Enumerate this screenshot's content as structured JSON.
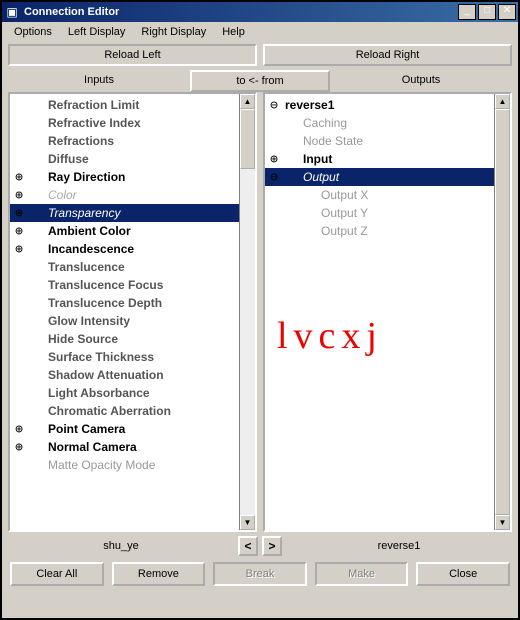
{
  "window": {
    "title": "Connection Editor"
  },
  "menu": [
    "Options",
    "Left Display",
    "Right Display",
    "Help"
  ],
  "buttons": {
    "reload_left": "Reload Left",
    "reload_right": "Reload Right",
    "clear_all": "Clear All",
    "remove": "Remove",
    "break_": "Break",
    "make": "Make",
    "close": "Close"
  },
  "headers": {
    "inputs": "Inputs",
    "outputs": "Outputs",
    "tofrom": "to <- from"
  },
  "status": {
    "left": "shu_ye",
    "right": "reverse1"
  },
  "watermark": "lvcxj",
  "left_items": [
    {
      "label": "Refraction Limit",
      "style": "darkgray",
      "indent": 1,
      "exp": ""
    },
    {
      "label": "Refractive Index",
      "style": "darkgray",
      "indent": 1,
      "exp": ""
    },
    {
      "label": "Refractions",
      "style": "darkgray",
      "indent": 1,
      "exp": ""
    },
    {
      "label": "Diffuse",
      "style": "darkgray",
      "indent": 1,
      "exp": ""
    },
    {
      "label": "Ray Direction",
      "style": "bold",
      "indent": 1,
      "exp": "plus"
    },
    {
      "label": "Color",
      "style": "italic",
      "indent": 1,
      "exp": "plus"
    },
    {
      "label": "Transparency",
      "style": "sel",
      "indent": 1,
      "exp": "plus"
    },
    {
      "label": "Ambient Color",
      "style": "bold",
      "indent": 1,
      "exp": "plus"
    },
    {
      "label": "Incandescence",
      "style": "bold",
      "indent": 1,
      "exp": "plus"
    },
    {
      "label": "Translucence",
      "style": "darkgray",
      "indent": 1,
      "exp": ""
    },
    {
      "label": "Translucence Focus",
      "style": "darkgray",
      "indent": 1,
      "exp": ""
    },
    {
      "label": "Translucence Depth",
      "style": "darkgray",
      "indent": 1,
      "exp": ""
    },
    {
      "label": "Glow Intensity",
      "style": "darkgray",
      "indent": 1,
      "exp": ""
    },
    {
      "label": "Hide Source",
      "style": "darkgray",
      "indent": 1,
      "exp": ""
    },
    {
      "label": "Surface Thickness",
      "style": "darkgray",
      "indent": 1,
      "exp": ""
    },
    {
      "label": "Shadow Attenuation",
      "style": "darkgray",
      "indent": 1,
      "exp": ""
    },
    {
      "label": "Light Absorbance",
      "style": "darkgray",
      "indent": 1,
      "exp": ""
    },
    {
      "label": "Chromatic Aberration",
      "style": "darkgray",
      "indent": 1,
      "exp": ""
    },
    {
      "label": "Point Camera",
      "style": "bold",
      "indent": 1,
      "exp": "plus"
    },
    {
      "label": "Normal Camera",
      "style": "bold",
      "indent": 1,
      "exp": "plus"
    },
    {
      "label": "Matte Opacity Mode",
      "style": "gray",
      "indent": 1,
      "exp": ""
    }
  ],
  "right_items": [
    {
      "label": "reverse1",
      "style": "bold",
      "indent": 0,
      "exp": "minus"
    },
    {
      "label": "Caching",
      "style": "gray",
      "indent": 1,
      "exp": ""
    },
    {
      "label": "Node State",
      "style": "gray",
      "indent": 1,
      "exp": ""
    },
    {
      "label": "Input",
      "style": "bold",
      "indent": 1,
      "exp": "plus"
    },
    {
      "label": "Output",
      "style": "sel",
      "indent": 1,
      "exp": "minus"
    },
    {
      "label": "Output X",
      "style": "gray",
      "indent": 2,
      "exp": ""
    },
    {
      "label": "Output Y",
      "style": "gray",
      "indent": 2,
      "exp": ""
    },
    {
      "label": "Output Z",
      "style": "gray",
      "indent": 2,
      "exp": ""
    }
  ]
}
